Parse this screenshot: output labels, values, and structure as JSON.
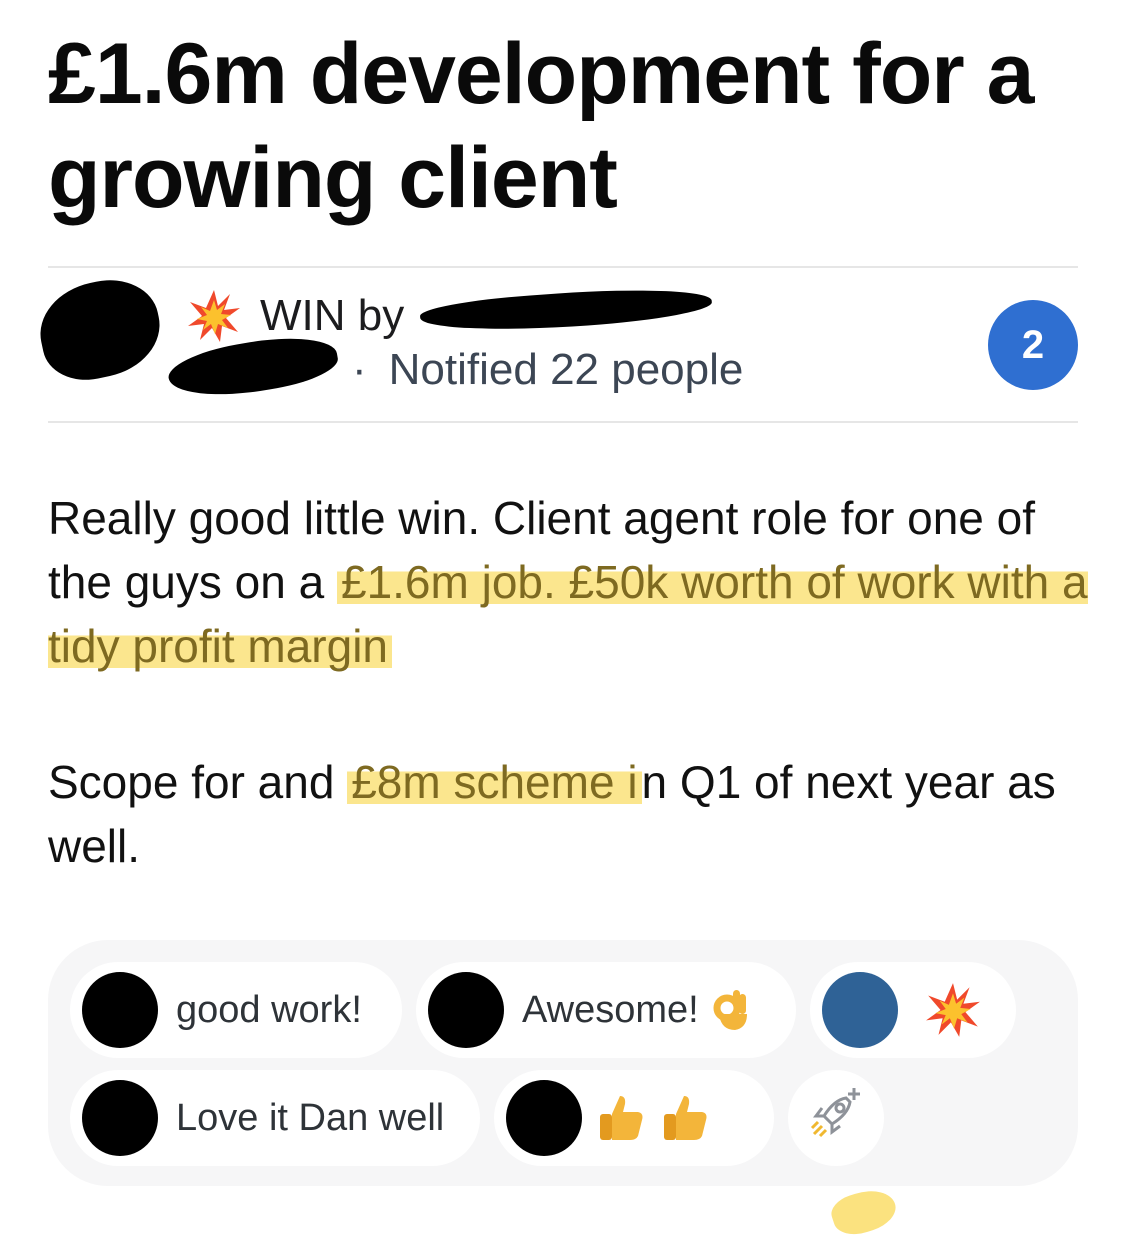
{
  "post": {
    "title": "£1.6m development for a growing client",
    "win_label": "WIN by",
    "notified_text": "Notified 22 people",
    "comment_count": "2",
    "paragraph1_lead": "Really good little win. Client agent role for one of the guys on a ",
    "paragraph1_highlight": "£1.6m job. £50k worth of work with a tidy profit margin",
    "paragraph2_lead": "Scope for and ",
    "paragraph2_highlight": "£8m scheme i",
    "paragraph2_tail": "n Q1 of next year as well."
  },
  "reactions": [
    {
      "text": "good work!"
    },
    {
      "text": "Awesome!",
      "emoji": "ok-hand"
    },
    {
      "emoji": "collision",
      "avatar_color": "#2f6296"
    },
    {
      "text": "Love it Dan well"
    },
    {
      "emoji": "thumbs-up-x2"
    },
    {
      "emoji": "add-reaction-rocket"
    }
  ],
  "colors": {
    "badge": "#2f6fd1",
    "highlight": "#fadd68",
    "highlight_text": "#7e6a21"
  }
}
